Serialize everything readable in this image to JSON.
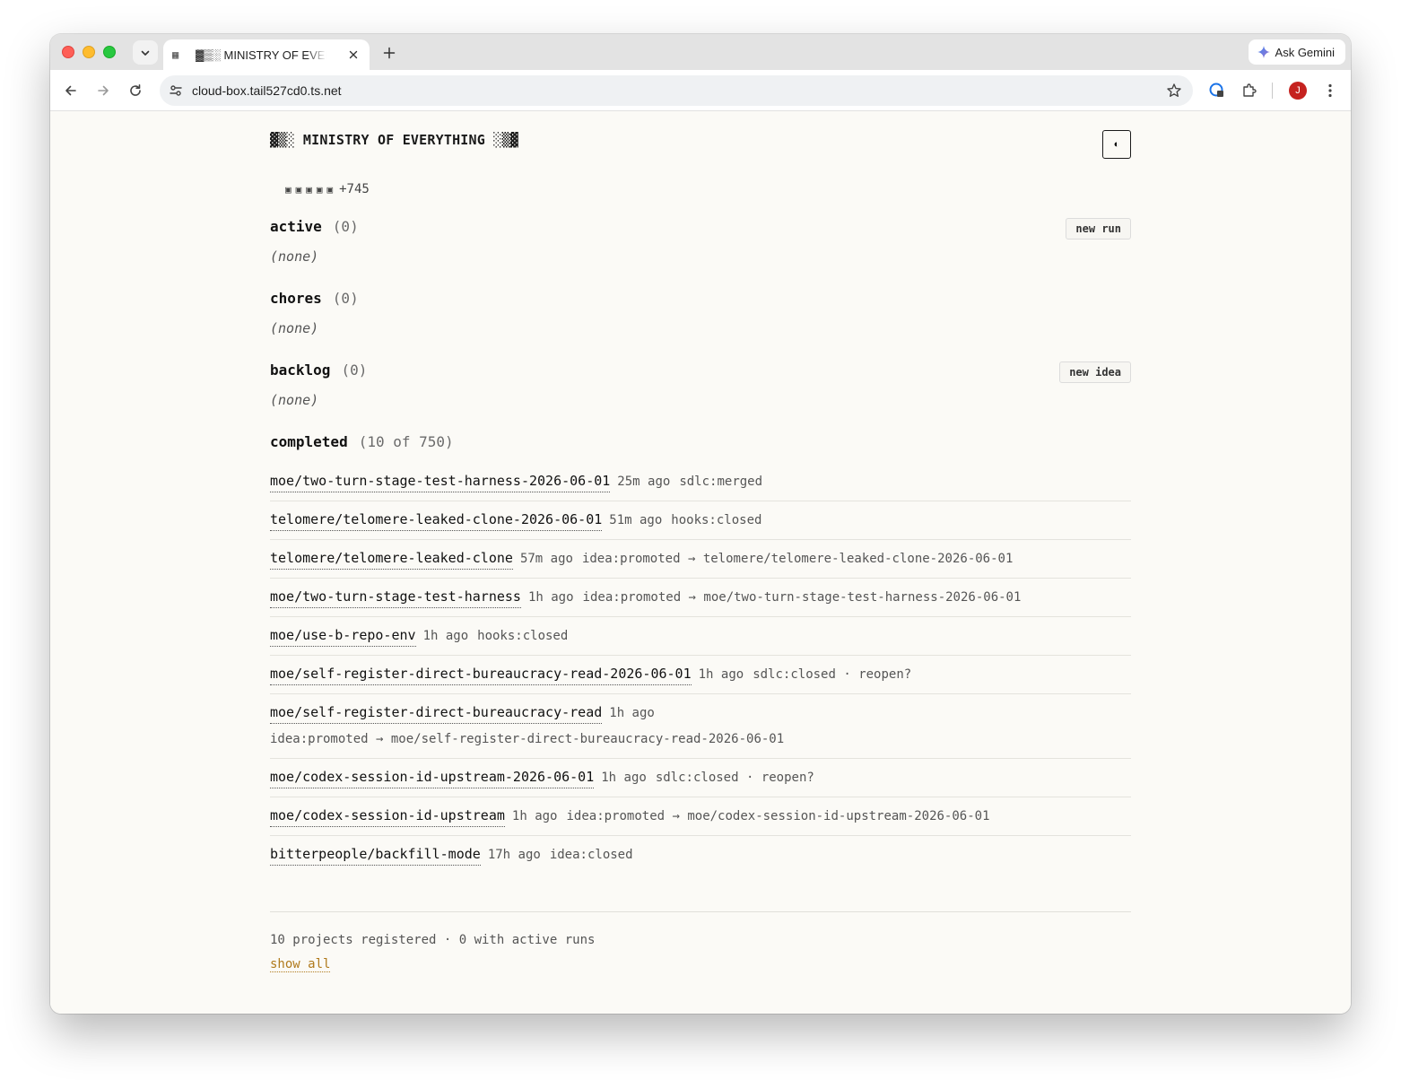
{
  "browser": {
    "tab_title": "▓▒░ MINISTRY OF EVERYTHING ░▒▓",
    "tab_favicon": "▦",
    "new_tab": "+",
    "ask_gemini": "Ask Gemini",
    "url": "cloud-box.tail527cd0.ts.net",
    "avatar_letter": "J"
  },
  "site": {
    "title": "▓▒░ MINISTRY OF EVERYTHING ░▒▓",
    "theme_toggle": "◐",
    "squares": [
      "▣",
      "▣",
      "▣",
      "▣",
      "▣"
    ],
    "squares_more": "+745"
  },
  "sections": {
    "active": {
      "label": "active",
      "count": "(0)",
      "empty": "(none)",
      "button": "new run"
    },
    "chores": {
      "label": "chores",
      "count": "(0)",
      "empty": "(none)"
    },
    "backlog": {
      "label": "backlog",
      "count": "(0)",
      "empty": "(none)",
      "button": "new idea"
    },
    "completed": {
      "label": "completed",
      "count": "(10 of 750)"
    }
  },
  "completed": [
    {
      "name": "moe/two-turn-stage-test-harness-2026-06-01",
      "ago": "25m ago",
      "status": "sdlc:merged"
    },
    {
      "name": "telomere/telomere-leaked-clone-2026-06-01",
      "ago": "51m ago",
      "status": "hooks:closed"
    },
    {
      "name": "telomere/telomere-leaked-clone",
      "ago": "57m ago",
      "status": "idea:promoted → telomere/telomere-leaked-clone-2026-06-01"
    },
    {
      "name": "moe/two-turn-stage-test-harness",
      "ago": "1h ago",
      "status": "idea:promoted → moe/two-turn-stage-test-harness-2026-06-01"
    },
    {
      "name": "moe/use-b-repo-env",
      "ago": "1h ago",
      "status": "hooks:closed"
    },
    {
      "name": "moe/self-register-direct-bureaucracy-read-2026-06-01",
      "ago": "1h ago",
      "status": "sdlc:closed · reopen?"
    },
    {
      "name": "moe/self-register-direct-bureaucracy-read",
      "ago": "1h ago",
      "status": "idea:promoted → moe/self-register-direct-bureaucracy-read-2026-06-01"
    },
    {
      "name": "moe/codex-session-id-upstream-2026-06-01",
      "ago": "1h ago",
      "status": "sdlc:closed · reopen?"
    },
    {
      "name": "moe/codex-session-id-upstream",
      "ago": "1h ago",
      "status": "idea:promoted → moe/codex-session-id-upstream-2026-06-01"
    },
    {
      "name": "bitterpeople/backfill-mode",
      "ago": "17h ago",
      "status": "idea:closed"
    }
  ],
  "footer": {
    "summary": "10 projects registered · 0 with active runs",
    "show_all": "show all"
  }
}
